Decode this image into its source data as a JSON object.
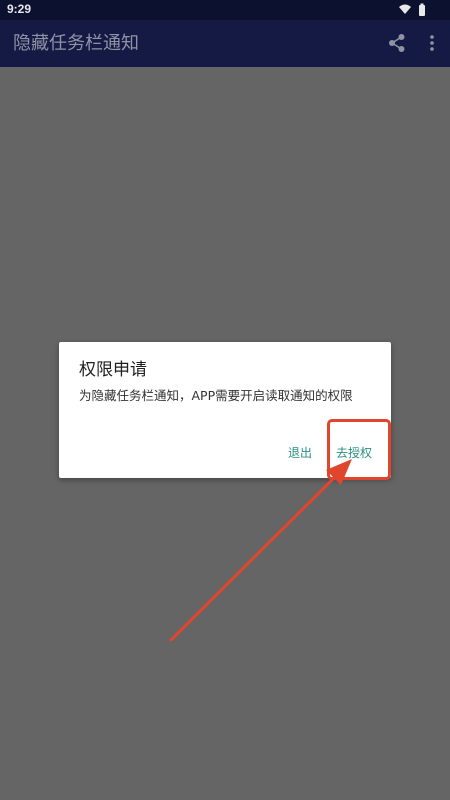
{
  "status_bar": {
    "time": "9:29",
    "icons": [
      "wifi-icon",
      "battery-icon"
    ]
  },
  "app_bar": {
    "title": "隐藏任务栏通知",
    "actions": [
      "share-icon",
      "more-vert-icon"
    ]
  },
  "dialog": {
    "title": "权限申请",
    "message": "为隐藏任务栏通知，APP需要开启读取通知的权限",
    "negative_button": "退出",
    "positive_button": "去授权"
  },
  "annotation": {
    "color": "#e0452d"
  },
  "colors": {
    "status_bar": "#0b112e",
    "app_bar": "#151a44",
    "scrim": "#656565",
    "accent": "#2a8f82"
  }
}
